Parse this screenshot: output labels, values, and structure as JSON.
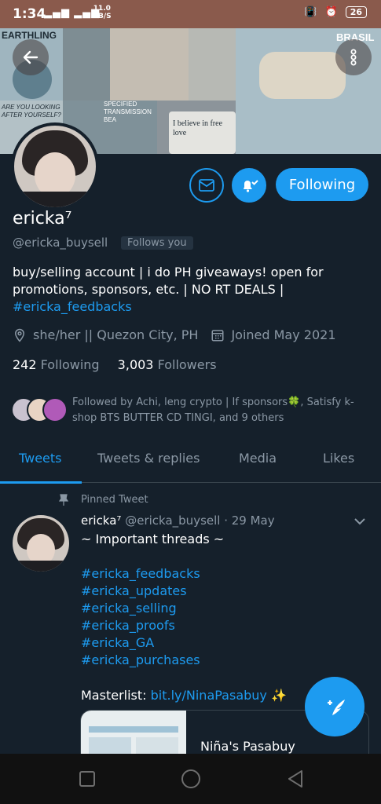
{
  "status_bar": {
    "time": "1:34",
    "signal": "▂▄▆ ▂▄▆",
    "net_speed_value": "11.0",
    "net_speed_unit": "KB/S",
    "battery": "26"
  },
  "banner": {
    "earthling": "EARTHLING",
    "brasil": "BRASIL",
    "are_you": "ARE YOU LOOKING AFTER YOURSELF?",
    "specified": "SPECIFIED TRANSMISSION BEA",
    "believe": "I believe in free love"
  },
  "profile": {
    "name": "ericka⁷",
    "handle": "@ericka_buysell",
    "follows_you": "Follows you",
    "bio_text": "buy/selling account | i do PH giveaways! open for promotions, sponsors, etc. | NO RT DEALS |",
    "bio_link": "#ericka_feedbacks",
    "pronouns_location": "she/her || Quezon City, PH",
    "joined": "Joined May 2021",
    "following_count": "242",
    "following_label": "Following",
    "followers_count": "3,003",
    "followers_label": "Followers",
    "followed_by": "Followed by Achi, leng crypto | If sponsors🍀, Satisfy k-shop BTS BUTTER CD TINGI, and 9 others",
    "follow_button": "Following"
  },
  "tabs": [
    {
      "label": "Tweets",
      "active": true
    },
    {
      "label": "Tweets & replies",
      "active": false
    },
    {
      "label": "Media",
      "active": false
    },
    {
      "label": "Likes",
      "active": false
    }
  ],
  "tweet": {
    "pinned_label": "Pinned Tweet",
    "author": "ericka⁷",
    "author_handle_date": "@ericka_buysell · 29 May",
    "line1": "~ Important threads ~",
    "hashtags": [
      "#ericka_feedbacks",
      "#ericka_updates",
      "#ericka_selling",
      "#ericka_proofs",
      "#ericka_GA",
      "#ericka_purchases"
    ],
    "masterlist_label": "Masterlist:",
    "masterlist_link": "bit.ly/NinaPasabuy",
    "sparkle": "✨",
    "card_title": "Niña's Pasabuy"
  },
  "colors": {
    "accent": "#1d9bf0",
    "background": "#15202b",
    "muted": "#8b98a5",
    "status_bar": "#8a5a4c"
  },
  "icons": [
    "back-arrow-icon",
    "more-vertical-icon",
    "mail-icon",
    "bell-check-icon",
    "location-icon",
    "calendar-icon",
    "pin-icon",
    "chevron-down-icon",
    "compose-icon",
    "nav-square-icon",
    "nav-circle-icon",
    "nav-triangle-icon"
  ]
}
